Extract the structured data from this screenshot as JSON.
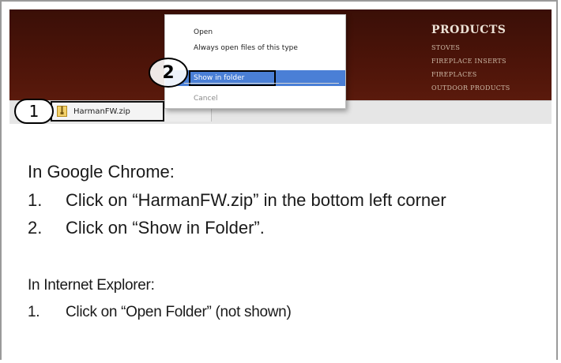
{
  "browser": {
    "context_menu": {
      "items": [
        {
          "label": "Open",
          "state": "normal"
        },
        {
          "label": "Always open files of this type",
          "state": "normal"
        },
        {
          "label": "Show in folder",
          "state": "highlighted"
        },
        {
          "label": "Cancel",
          "state": "disabled"
        }
      ]
    },
    "download": {
      "filename": "HarmanFW.zip",
      "icon": "zip-file-icon"
    }
  },
  "website": {
    "products_title": "PRODUCTS",
    "products_items": [
      "STOVES",
      "FIREPLACE INSERTS",
      "FIREPLACES",
      "OUTDOOR PRODUCTS"
    ]
  },
  "callouts": {
    "one": "1",
    "two": "2"
  },
  "instructions": {
    "chrome_heading": "In Google Chrome:",
    "chrome_steps": [
      {
        "num": "1.",
        "text": "Click on “HarmanFW.zip” in the bottom left corner"
      },
      {
        "num": "2.",
        "text": "Click on “Show in Folder”."
      }
    ],
    "ie_heading": "In Internet Explorer:",
    "ie_steps": [
      {
        "num": "1.",
        "text": "Click on “Open Folder” (not shown)"
      }
    ]
  },
  "colors": {
    "site_header": "#4d1409",
    "menu_highlight": "#4a7fd6",
    "download_bar": "#e6e6e6"
  }
}
